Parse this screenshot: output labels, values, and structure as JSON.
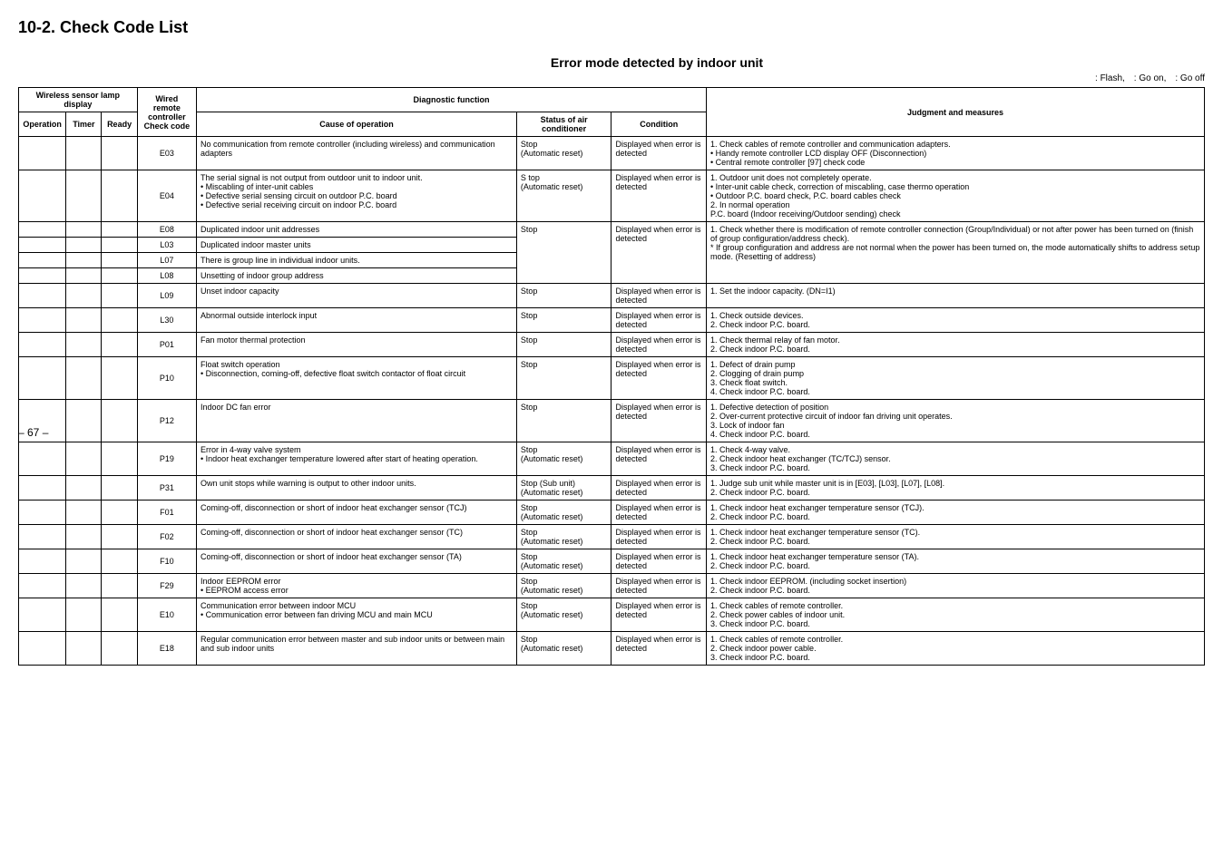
{
  "section_number": "10-2.",
  "section_title": "Check Code List",
  "table_title": "Error mode detected by indoor unit",
  "legend": ": Flash, : Go on, : Go off",
  "page_number": "– 67 –",
  "headers": {
    "wireless_sensor": "Wireless sensor lamp display",
    "operation": "Operation",
    "timer": "Timer",
    "ready": "Ready",
    "wired_remote": "Wired remote controller",
    "check_code": "Check code",
    "diagnostic": "Diagnostic function",
    "cause": "Cause of operation",
    "status": "Status of air conditioner",
    "condition": "Condition",
    "judgment": "Judgment and measures"
  },
  "rows": [
    {
      "code": "E03",
      "cause": "No communication from remote controller (including wireless) and communication adapters",
      "status": "Stop\n(Automatic reset)",
      "condition": "Displayed when error is detected",
      "judgment": "1. Check cables of remote controller and communication adapters.\n  • Handy remote controller LCD display OFF (Disconnection)\n  • Central remote controller [97] check code"
    },
    {
      "code": "E04",
      "cause": "The serial signal is not output from outdoor unit to indoor unit.\n• Miscabling of inter-unit cables\n• Defective serial sensing circuit on outdoor P.C. board\n• Defective serial receiving circuit on indoor P.C. board",
      "status": "S top\n(Automatic reset)",
      "condition": "Displayed when error is detected",
      "judgment": "1. Outdoor unit does not completely operate.\n  • Inter-unit cable check, correction of miscabling, case thermo operation\n  • Outdoor P.C. board check, P.C. board cables check\n2. In normal operation\n  P.C. board (Indoor receiving/Outdoor sending) check"
    },
    {
      "code": "E08",
      "cause": "Duplicated indoor unit addresses",
      "status": "Stop",
      "condition": "Displayed when error is detected",
      "judgment": "1. Check whether there is modification of remote controller connection (Group/Individual) or not after power has been turned on (finish of group configuration/address check).\n* If group configuration and address are not normal when the power has been turned on, the mode automatically shifts to address setup mode. (Resetting of address)",
      "rowspan_status": 4
    },
    {
      "code": "L03",
      "cause": "Duplicated indoor master units"
    },
    {
      "code": "L07",
      "cause": "There is group line in individual indoor units."
    },
    {
      "code": "L08",
      "cause": "Unsetting of indoor group address"
    },
    {
      "code": "L09",
      "cause": "Unset indoor capacity",
      "status": "Stop",
      "condition": "Displayed when error is detected",
      "judgment": "1. Set the indoor capacity. (DN=I1)"
    },
    {
      "code": "L30",
      "cause": "Abnormal outside interlock input",
      "status": "Stop",
      "condition": "Displayed when error is detected",
      "judgment": "1. Check outside devices.\n2. Check indoor P.C. board."
    },
    {
      "code": "P01",
      "cause": "Fan motor thermal protection",
      "status": "Stop",
      "condition": "Displayed when error is detected",
      "judgment": "1. Check thermal relay of fan motor.\n2. Check indoor P.C. board."
    },
    {
      "code": "P10",
      "cause": "Float switch operation\n• Disconnection, coming-off, defective float switch contactor of float circuit",
      "status": "Stop",
      "condition": "Displayed when error is detected",
      "judgment": "1. Defect of drain pump\n2. Clogging of drain pump\n3. Check float switch.\n4. Check indoor P.C. board."
    },
    {
      "code": "P12",
      "cause": "Indoor DC fan error",
      "status": "Stop",
      "condition": "Displayed when error is detected",
      "judgment": "1. Defective detection of position\n2. Over-current protective circuit of indoor fan driving unit operates.\n3. Lock of indoor fan\n4. Check indoor P.C. board."
    },
    {
      "code": "P19",
      "cause": "Error in 4-way valve system\n• Indoor heat exchanger temperature lowered after start of heating operation.",
      "status": "Stop\n(Automatic reset)",
      "condition": "Displayed when error is detected",
      "judgment": "1. Check 4-way valve.\n2. Check indoor heat exchanger (TC/TCJ) sensor.\n3. Check indoor P.C. board."
    },
    {
      "code": "P31",
      "cause": "Own unit stops while warning is output to other indoor units.",
      "status": "Stop (Sub unit)\n(Automatic reset)",
      "condition": "Displayed when error is detected",
      "judgment": "1. Judge sub unit while master unit is in [E03], [L03], [L07], [L08].\n2. Check indoor P.C. board."
    },
    {
      "code": "F01",
      "cause": "Coming-off, disconnection or short of indoor heat exchanger sensor (TCJ)",
      "status": "Stop\n(Automatic reset)",
      "condition": "Displayed when error is detected",
      "judgment": "1. Check indoor heat exchanger temperature sensor (TCJ).\n2. Check indoor P.C. board."
    },
    {
      "code": "F02",
      "cause": "Coming-off, disconnection or short of indoor heat exchanger sensor (TC)",
      "status": "Stop\n(Automatic reset)",
      "condition": "Displayed when error is detected",
      "judgment": "1. Check indoor heat exchanger temperature sensor (TC).\n2. Check indoor P.C. board."
    },
    {
      "code": "F10",
      "cause": "Coming-off, disconnection or short of indoor heat exchanger sensor (TA)",
      "status": "Stop\n(Automatic reset)",
      "condition": "Displayed when error is detected",
      "judgment": "1. Check indoor heat exchanger temperature sensor (TA).\n2. Check indoor P.C. board."
    },
    {
      "code": "F29",
      "cause": "Indoor EEPROM error\n• EEPROM access error",
      "status": "Stop\n(Automatic reset)",
      "condition": "Displayed when error is detected",
      "judgment": "1. Check indoor EEPROM. (including socket insertion)\n2. Check indoor P.C. board."
    },
    {
      "code": "E10",
      "cause": "Communication error between indoor MCU\n• Communication error between fan driving MCU and main MCU",
      "status": "Stop\n(Automatic reset)",
      "condition": "Displayed when error is detected",
      "judgment": "1. Check cables of remote controller.\n2. Check power cables of indoor unit.\n3. Check indoor P.C. board."
    },
    {
      "code": "E18",
      "cause": "Regular communication error between master and sub indoor units or between main and sub indoor units",
      "status": "Stop\n(Automatic reset)",
      "condition": "Displayed when error is detected",
      "judgment": "1. Check cables of remote controller.\n2. Check indoor power cable.\n3. Check indoor P.C. board."
    }
  ]
}
